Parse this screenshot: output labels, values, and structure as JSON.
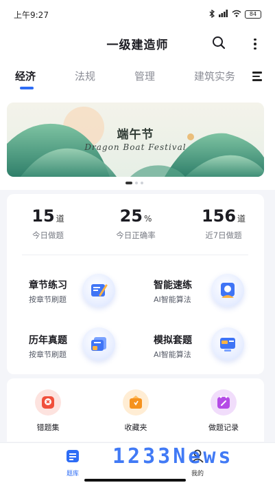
{
  "status_bar": {
    "time": "上午9:27",
    "bluetooth_icon": "bluetooth-icon",
    "signal_icon": "signal-icon",
    "wifi_icon": "wifi-icon",
    "battery": "84"
  },
  "header": {
    "title": "一级建造师",
    "search_icon": "search-icon",
    "more_icon": "more-vertical-icon"
  },
  "tabs": [
    {
      "label": "经济",
      "active": true
    },
    {
      "label": "法规",
      "active": false
    },
    {
      "label": "管理",
      "active": false
    },
    {
      "label": "建筑实务",
      "active": false
    }
  ],
  "tab_menu_icon": "menu-icon",
  "banner": {
    "title": "端午节",
    "subtitle": "Dragon Boat Festival",
    "slides": 3,
    "active_slide": 1
  },
  "stats": [
    {
      "value": "15",
      "unit": "道",
      "label": "今日做题"
    },
    {
      "value": "25",
      "unit": "%",
      "label": "今日正确率"
    },
    {
      "value": "156",
      "unit": "道",
      "label": "近7日做题"
    }
  ],
  "features": [
    {
      "title": "章节练习",
      "subtitle": "按章节刷题",
      "icon": "chapter-practice-icon"
    },
    {
      "title": "智能速练",
      "subtitle": "AI智能算法",
      "icon": "smart-practice-icon"
    },
    {
      "title": "历年真题",
      "subtitle": "按章节刷题",
      "icon": "past-exams-icon"
    },
    {
      "title": "模拟套题",
      "subtitle": "AI智能算法",
      "icon": "mock-exam-icon"
    }
  ],
  "quick_actions": [
    {
      "label": "错题集",
      "icon": "wrong-questions-icon",
      "color": "#f0503c"
    },
    {
      "label": "收藏夹",
      "icon": "favorites-icon",
      "color": "#f5921e"
    },
    {
      "label": "做题记录",
      "icon": "history-icon",
      "color": "#b54be6"
    }
  ],
  "bottom_nav": [
    {
      "label": "题库",
      "icon": "question-bank-icon",
      "active": true
    },
    {
      "label": "我的",
      "icon": "profile-icon",
      "active": false
    }
  ],
  "watermark": "1233News",
  "colors": {
    "accent": "#2d6cf5",
    "background": "#f4f5f9"
  }
}
